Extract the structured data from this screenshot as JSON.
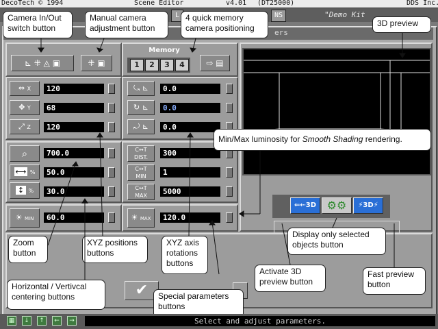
{
  "menubar": {
    "copyright": "DecoTech © 1994",
    "app": "Scene Editor",
    "version": "v4.01",
    "build": "(DT25000)",
    "company": "DDS Inc."
  },
  "titlebar": {
    "tab_a": "L",
    "tab_b": "NS",
    "scene_name": "\"Demo Kit"
  },
  "window": {
    "header_fragment": "ers"
  },
  "memory": {
    "title": "Memory",
    "slots": [
      "1",
      "2",
      "3",
      "4"
    ]
  },
  "fields": {
    "pos_x": "120",
    "pos_y": "68",
    "pos_z": "120",
    "rot_x": "0.0",
    "rot_y": "0.0",
    "rot_z": "0.0",
    "zoom": "700.0",
    "h_center": "50.0",
    "v_center": "30.0",
    "dist": "300",
    "t_min": "1",
    "t_max": "5000",
    "lum_min": "60.0",
    "lum_max": "120.0"
  },
  "labels": {
    "x": "X",
    "y": "Y",
    "z": "Z",
    "pct": "%",
    "min": "MIN",
    "max": "MAX",
    "dist": "DIST.",
    "c_t": "C↔T"
  },
  "preview_modes": {
    "activate": "⇐⇠3D",
    "fast": "⚡3D⚡"
  },
  "status": {
    "message": "Select and adjust parameters."
  },
  "callouts": {
    "camera_switch": "Camera In/Out switch button",
    "manual_camera": "Manual camera adjustment button",
    "quick_memory": "4 quick memory camera positioning",
    "preview_3d": "3D preview",
    "luminosity_prefix": "Min/Max luminosity for ",
    "luminosity_em": "Smooth Shading",
    "luminosity_suffix": " rendering.",
    "zoom": "Zoom button",
    "xyz_positions": "XYZ positions buttons",
    "xyz_rotations": "XYZ axis rotations buttons",
    "display_selected": "Display only selected objects button",
    "activate_preview": "Activate 3D preview button",
    "fast_preview": "Fast preview button",
    "centering": "Horizontal / Vertivcal centering buttons",
    "special_params": "Special parameters buttons"
  },
  "colors": {
    "mode_active": "#2a6fd6",
    "mode_green": "#2d8a2d",
    "status_text": "#cfcfcf"
  }
}
